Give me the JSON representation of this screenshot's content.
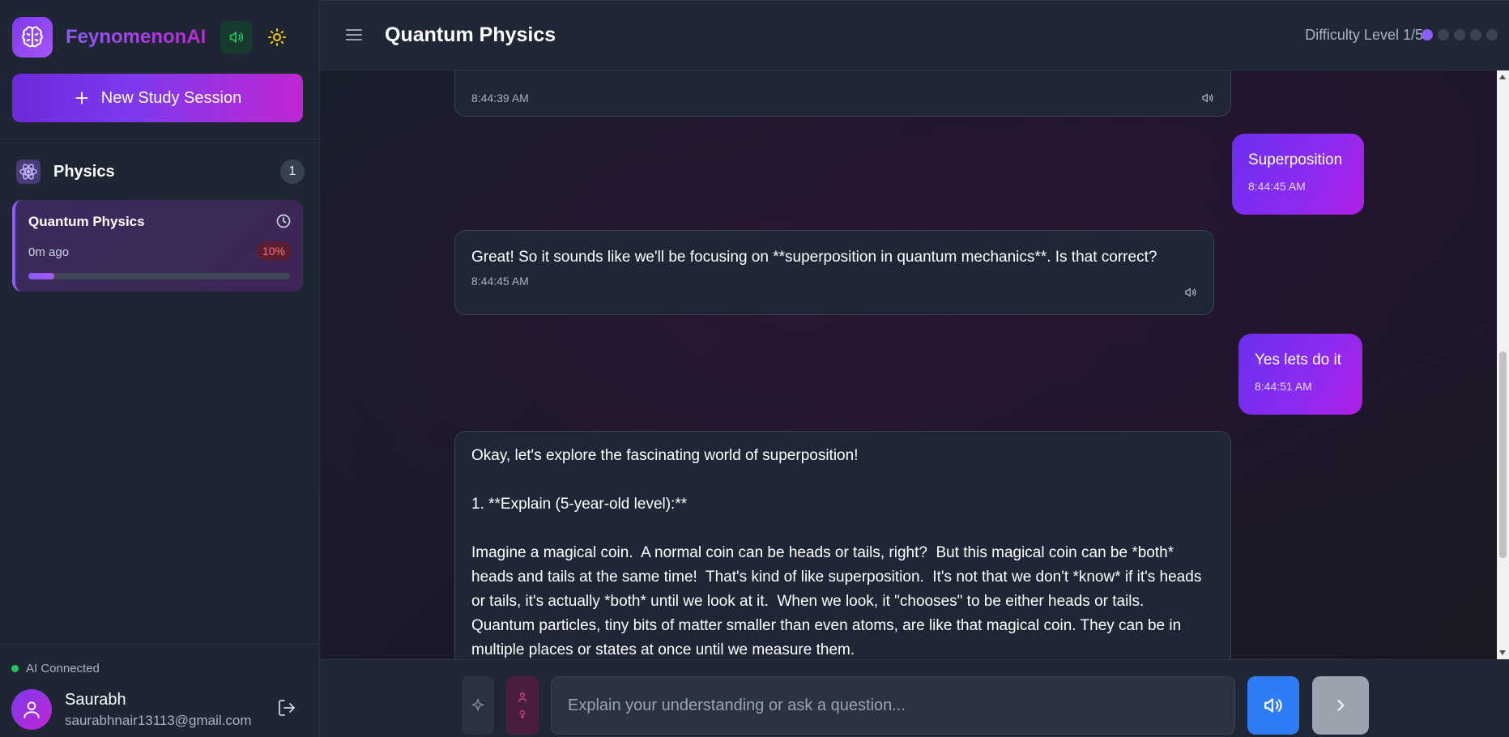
{
  "app": {
    "name": "FeynomenonAI",
    "accent": "#7c3aed",
    "accent_secondary": "#c026d3"
  },
  "sidebar": {
    "new_session_label": "New Study Session",
    "subject": {
      "name": "Physics",
      "count": "1",
      "icon": "atom-icon"
    },
    "sessions": [
      {
        "title": "Quantum Physics",
        "ago": "0m ago",
        "progress_label": "10%",
        "progress": 0.1
      }
    ],
    "status": {
      "label": "AI Connected",
      "color": "#22c55e"
    },
    "user": {
      "name": "Saurabh",
      "email": "saurabhnair13113@gmail.com"
    }
  },
  "header": {
    "title": "Quantum Physics",
    "difficulty_label": "Difficulty Level 1/5",
    "difficulty_level": 1,
    "difficulty_max": 5
  },
  "messages": [
    {
      "role": "ai",
      "time": "8:44:39 AM"
    },
    {
      "role": "user",
      "text": "Superposition",
      "time": "8:44:45 AM"
    },
    {
      "role": "ai",
      "text": "Great!  So it sounds like we'll be focusing on **superposition in quantum mechanics**. Is that correct?",
      "time": "8:44:45 AM"
    },
    {
      "role": "user",
      "text": "Yes lets do it",
      "time": "8:44:51 AM"
    },
    {
      "role": "ai",
      "text": "Okay, let's explore the fascinating world of superposition!\n\n1. **Explain (5-year-old level):**\n\nImagine a magical coin.  A normal coin can be heads or tails, right?  But this magical coin can be *both* heads and tails at the same time!  That's kind of like superposition.  It's not that we don't *know* if it's heads or tails, it's actually *both* until we look at it.  When we look, it \"chooses\" to be either heads or tails.  Quantum particles, tiny bits of matter smaller than even atoms, are like that magical coin. They can be in multiple places or states at once until we measure them."
    }
  ],
  "composer": {
    "placeholder": "Explain your understanding or ask a question..."
  }
}
